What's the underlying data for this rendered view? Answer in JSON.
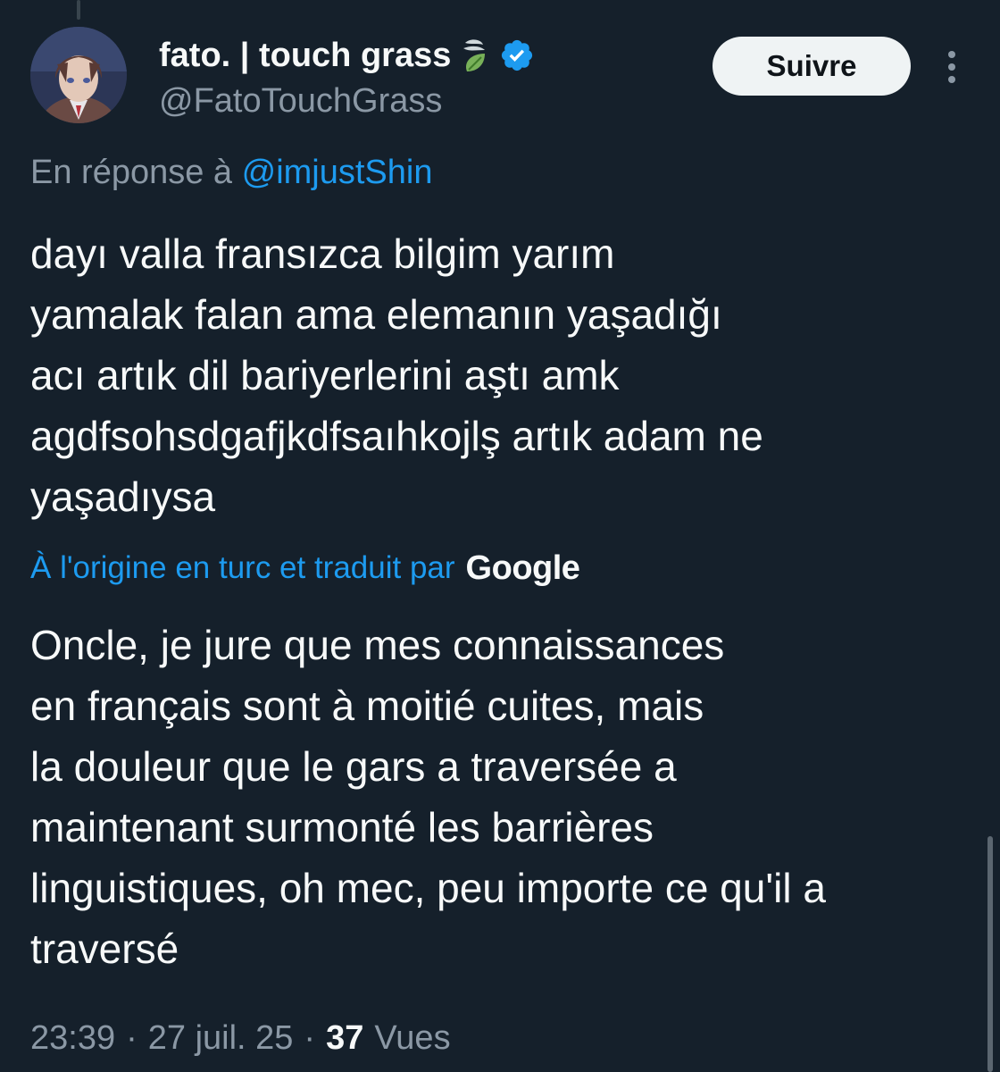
{
  "author": {
    "display_name": "fato. | touch grass",
    "handle": "@FatoTouchGrass",
    "badges": [
      "leaf-emoji-icon",
      "verified-icon"
    ],
    "avatar": "avatar"
  },
  "follow_button": {
    "label": "Suivre"
  },
  "more_menu": {
    "icon": "more-vertical-icon"
  },
  "reply_context": {
    "prefix": "En réponse à",
    "mention": "@imjustShin"
  },
  "tweet": {
    "lines": [
      "dayı valla fransızca bilgim yarım",
      "yamalak falan ama elemanın yaşadığı",
      "acı artık dil bariyerlerini aştı amk",
      "agdfsohsdgafjkdfsaıhkojlş artık adam ne",
      "yaşadıysa"
    ]
  },
  "translation": {
    "label": "À l'origine en turc et traduit par",
    "provider": "Google",
    "lines": [
      "Oncle, je jure que mes connaissances",
      "en français sont à moitié cuites, mais",
      "la douleur que le gars a traversée a",
      "maintenant surmonté les barrières",
      "linguistiques, oh mec, peu importe ce qu'il a",
      "traversé"
    ]
  },
  "meta": {
    "time": "23:39",
    "separator": "·",
    "date": "27 juil. 25",
    "views_count": "37",
    "views_label": "Vues"
  },
  "colors": {
    "background": "#15202b",
    "text": "#f7f9f9",
    "secondary": "#8b98a5",
    "accent": "#1d9bf0",
    "button_bg": "#eff3f4"
  }
}
